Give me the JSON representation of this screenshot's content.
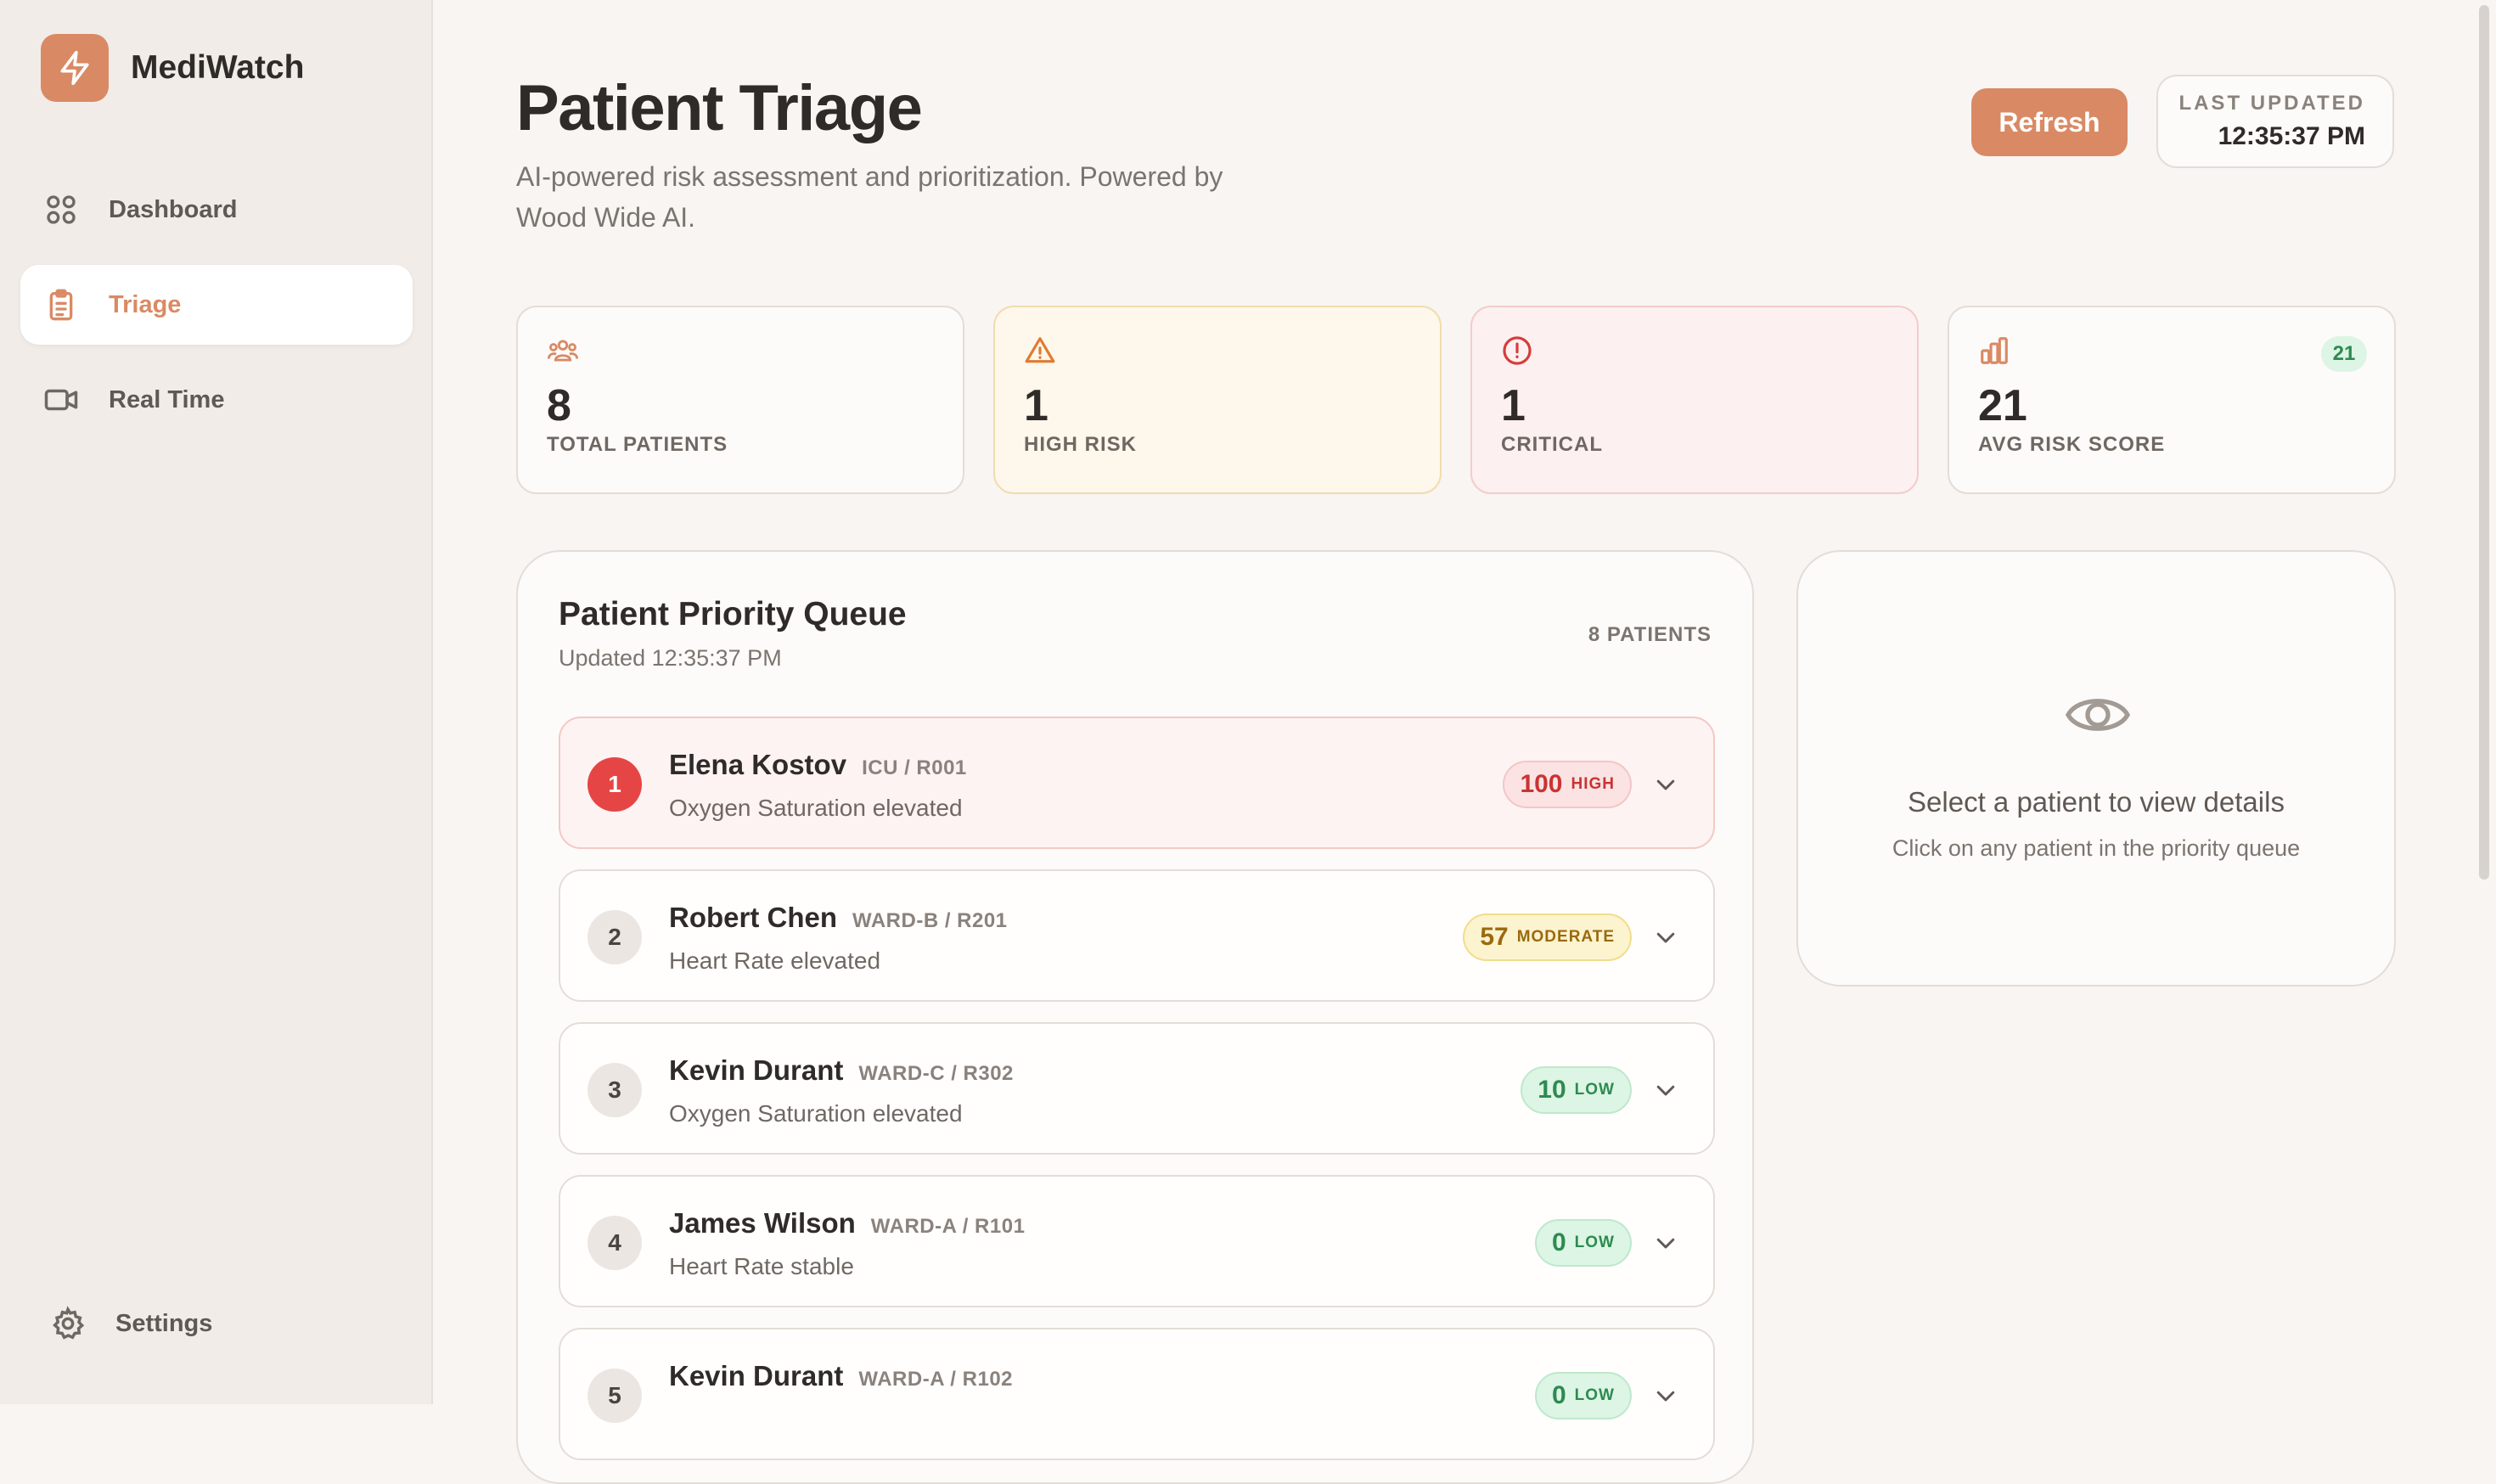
{
  "app": {
    "name": "MediWatch",
    "accent": "#d98a64"
  },
  "nav": {
    "items": [
      {
        "label": "Dashboard",
        "icon": "grid-icon"
      },
      {
        "label": "Triage",
        "icon": "clipboard-icon",
        "active": true
      },
      {
        "label": "Real Time",
        "icon": "video-icon"
      }
    ],
    "settings_label": "Settings"
  },
  "header": {
    "title": "Patient Triage",
    "subtitle": "AI-powered risk assessment and prioritization. Powered by Wood Wide AI.",
    "refresh_label": "Refresh",
    "last_updated_label": "LAST UPDATED",
    "last_updated_time": "12:35:37 PM"
  },
  "stats": {
    "total": {
      "value": "8",
      "label": "TOTAL PATIENTS",
      "icon": "users-icon"
    },
    "high": {
      "value": "1",
      "label": "HIGH RISK",
      "icon": "warning-icon"
    },
    "critical": {
      "value": "1",
      "label": "CRITICAL",
      "icon": "alert-circle-icon"
    },
    "avg": {
      "value": "21",
      "label": "AVG RISK SCORE",
      "badge": "21",
      "icon": "bar-chart-icon"
    }
  },
  "queue": {
    "title": "Patient Priority Queue",
    "updated": "Updated 12:35:37 PM",
    "count": "8 PATIENTS",
    "patients": [
      {
        "rank": "1",
        "name": "Elena Kostov",
        "location": "ICU / R001",
        "condition": "Oxygen Saturation elevated",
        "score": "100",
        "level": "HIGH"
      },
      {
        "rank": "2",
        "name": "Robert Chen",
        "location": "WARD-B / R201",
        "condition": "Heart Rate elevated",
        "score": "57",
        "level": "MODERATE"
      },
      {
        "rank": "3",
        "name": "Kevin Durant",
        "location": "WARD-C / R302",
        "condition": "Oxygen Saturation elevated",
        "score": "10",
        "level": "LOW"
      },
      {
        "rank": "4",
        "name": "James Wilson",
        "location": "WARD-A / R101",
        "condition": "Heart Rate stable",
        "score": "0",
        "level": "LOW"
      },
      {
        "rank": "5",
        "name": "Kevin Durant",
        "location": "WARD-A / R102",
        "condition": "",
        "score": "0",
        "level": "LOW"
      }
    ]
  },
  "details": {
    "title": "Select a patient to view details",
    "subtitle": "Click on any patient in the priority queue",
    "icon": "eye-icon"
  }
}
